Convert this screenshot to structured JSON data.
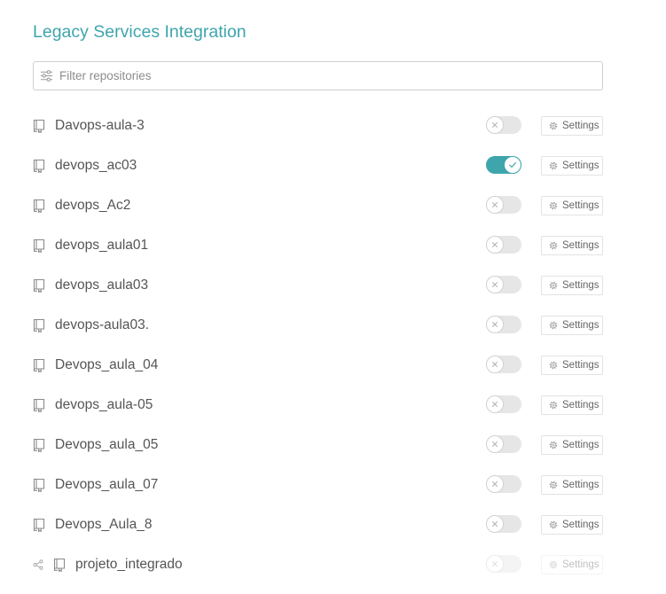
{
  "header": {
    "title": "Legacy Services Integration"
  },
  "filter": {
    "icon": "sliders-icon",
    "placeholder": "Filter repositories",
    "value": ""
  },
  "repositories": [
    {
      "name": "Davops-aula-3",
      "icon": "repo-icon",
      "enabled": false,
      "disabled": false,
      "settings_label": "Settings"
    },
    {
      "name": "devops_ac03",
      "icon": "repo-icon",
      "enabled": true,
      "disabled": false,
      "settings_label": "Settings"
    },
    {
      "name": "devops_Ac2",
      "icon": "repo-icon",
      "enabled": false,
      "disabled": false,
      "settings_label": "Settings"
    },
    {
      "name": "devops_aula01",
      "icon": "repo-icon",
      "enabled": false,
      "disabled": false,
      "settings_label": "Settings"
    },
    {
      "name": "devops_aula03",
      "icon": "repo-icon",
      "enabled": false,
      "disabled": false,
      "settings_label": "Settings"
    },
    {
      "name": "devops-aula03.",
      "icon": "repo-icon",
      "enabled": false,
      "disabled": false,
      "settings_label": "Settings"
    },
    {
      "name": "Devops_aula_04",
      "icon": "repo-icon",
      "enabled": false,
      "disabled": false,
      "settings_label": "Settings"
    },
    {
      "name": "devops_aula-05",
      "icon": "repo-icon",
      "enabled": false,
      "disabled": false,
      "settings_label": "Settings"
    },
    {
      "name": "Devops_aula_05",
      "icon": "repo-icon",
      "enabled": false,
      "disabled": false,
      "settings_label": "Settings"
    },
    {
      "name": "Devops_aula_07",
      "icon": "repo-icon",
      "enabled": false,
      "disabled": false,
      "settings_label": "Settings"
    },
    {
      "name": "Devops_Aula_8",
      "icon": "repo-icon",
      "enabled": false,
      "disabled": false,
      "settings_label": "Settings"
    },
    {
      "name": "projeto_integrado",
      "icon": "repo-icon",
      "leading_icon": "share-icon",
      "enabled": false,
      "disabled": true,
      "settings_label": "Settings"
    }
  ],
  "colors": {
    "accent": "#3fa5ad",
    "text": "#555555",
    "muted": "#8a8a8a",
    "toggle_off": "#e6e6e6"
  }
}
